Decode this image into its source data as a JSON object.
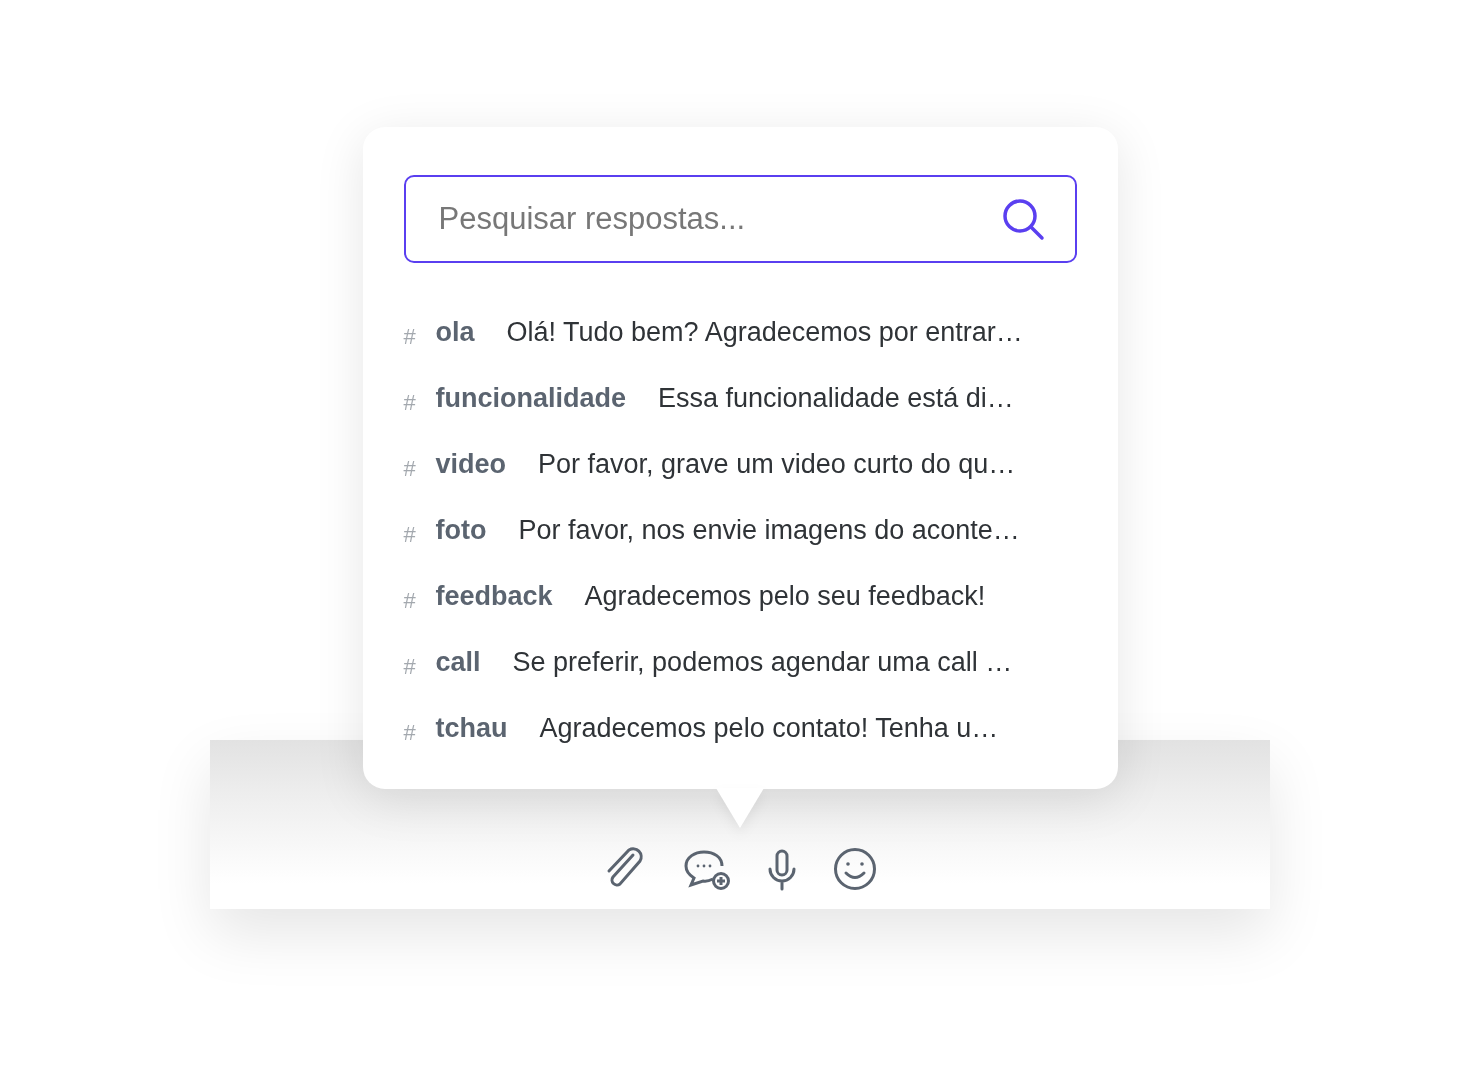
{
  "search": {
    "placeholder": "Pesquisar respostas..."
  },
  "replies": [
    {
      "hash": "#",
      "shortcut": "ola",
      "text": "Olá! Tudo bem? Agradecemos por entrar…"
    },
    {
      "hash": "#",
      "shortcut": "funcionalidade",
      "text": "Essa funcionalidade está di…"
    },
    {
      "hash": "#",
      "shortcut": "video",
      "text": "Por favor, grave um video curto do qu…"
    },
    {
      "hash": "#",
      "shortcut": "foto",
      "text": "Por favor, nos envie imagens do aconte…"
    },
    {
      "hash": "#",
      "shortcut": "feedback",
      "text": "Agradecemos pelo seu feedback!"
    },
    {
      "hash": "#",
      "shortcut": "call",
      "text": "Se preferir, podemos agendar uma call …"
    },
    {
      "hash": "#",
      "shortcut": "tchau",
      "text": "Agradecemos pelo contato! Tenha u…"
    }
  ]
}
